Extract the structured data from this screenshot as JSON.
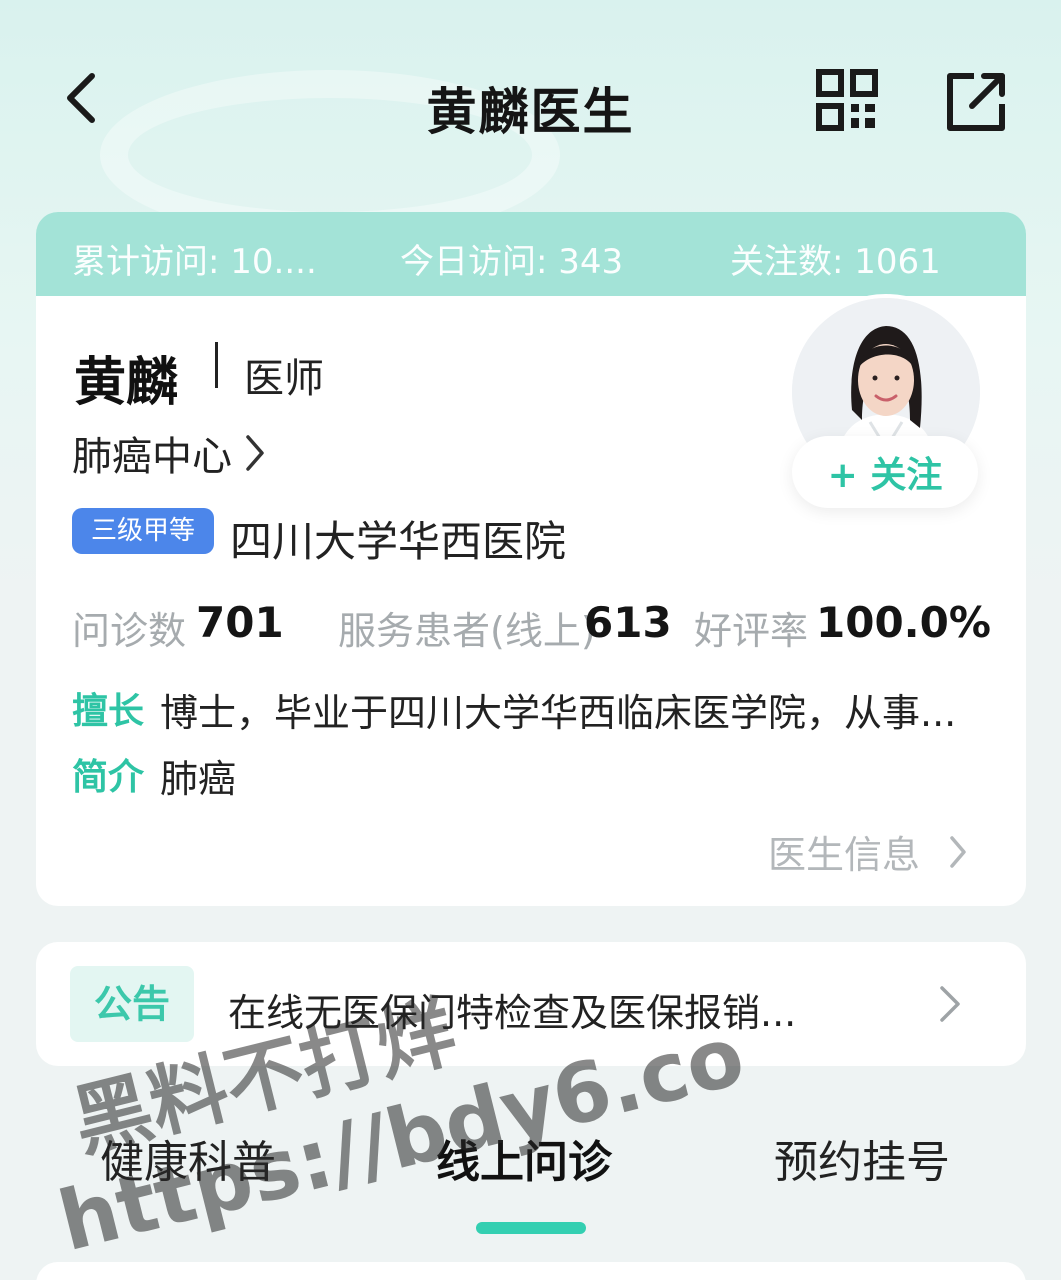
{
  "header": {
    "title": "黄麟医生",
    "back_icon": "chevron-left-icon",
    "qr_icon": "qr-code-icon",
    "share_icon": "share-icon"
  },
  "stats": {
    "total_visits": "累计访问: 10....",
    "today_visits": "今日访问:  343",
    "followers": "关注数:  1061"
  },
  "profile": {
    "name": "黄麟",
    "title": "医师",
    "department": "肺癌中心",
    "hospital_level": "三级甲等",
    "hospital": "四川大学华西医院",
    "follow_label": "+ 关注",
    "metrics": {
      "consult_label": "问诊数",
      "consult_value": "701",
      "patients_label": "服务患者(线上)",
      "patients_value": "613",
      "rating_label": "好评率",
      "rating_value": "100.0%"
    },
    "expertise_tag": "擅长",
    "expertise_text": "博士，毕业于四川大学华西临床医学院，从事...",
    "intro_tag": "简介",
    "intro_text": "肺癌",
    "more_info": "医生信息"
  },
  "notice": {
    "tag": "公告",
    "text": "在线无医保门特检查及医保报销..."
  },
  "tabs": [
    {
      "label": "健康科普",
      "active": false
    },
    {
      "label": "线上问诊",
      "active": true
    },
    {
      "label": "预约挂号",
      "active": false
    }
  ],
  "watermark": {
    "line1": "黑料不打烊",
    "line2": "https://bdy6.co"
  },
  "colors": {
    "accent": "#2ec4a5",
    "stats_strip": "#a3e3d7",
    "badge_blue": "#4c86ea",
    "muted": "#a6abae"
  }
}
